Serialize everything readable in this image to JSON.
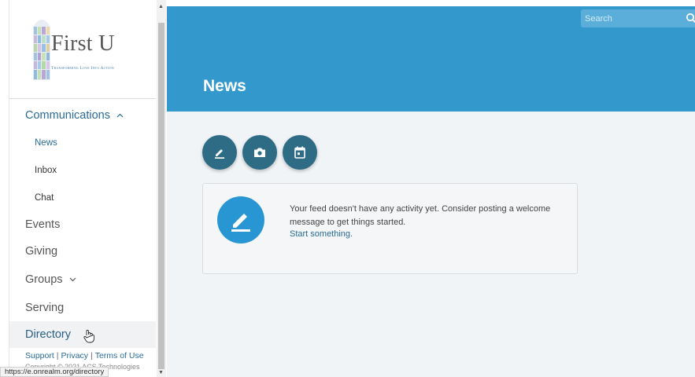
{
  "sidebar": {
    "logo": {
      "title": "First U",
      "tagline": "Transforming Love Into Action"
    },
    "nav": {
      "communications": "Communications",
      "news": "News",
      "inbox": "Inbox",
      "chat": "Chat",
      "events": "Events",
      "giving": "Giving",
      "groups": "Groups",
      "serving": "Serving",
      "directory": "Directory"
    },
    "footer": {
      "support": "Support",
      "privacy": "Privacy",
      "terms": "Terms of Use",
      "copyright": "Copyright © 2021 ACS Technologies"
    }
  },
  "status_bar": {
    "url": "https://e.onrealm.org/directory"
  },
  "header": {
    "title": "News",
    "search_placeholder": "Search"
  },
  "feed": {
    "empty_message": "Your feed doesn't have any activity yet. Consider posting a welcome message to get things started.",
    "start_link": "Start something."
  },
  "colors": {
    "header_bg": "#3399cc",
    "action_button": "#2e6b85",
    "card_icon": "#2896d3",
    "link": "#2a6b98",
    "main_bg": "#f1f4f7"
  },
  "icons": [
    "pencil-icon",
    "camera-icon",
    "calendar-icon",
    "search-icon",
    "chevron-up-icon",
    "chevron-down-icon",
    "hand-cursor-icon"
  ]
}
